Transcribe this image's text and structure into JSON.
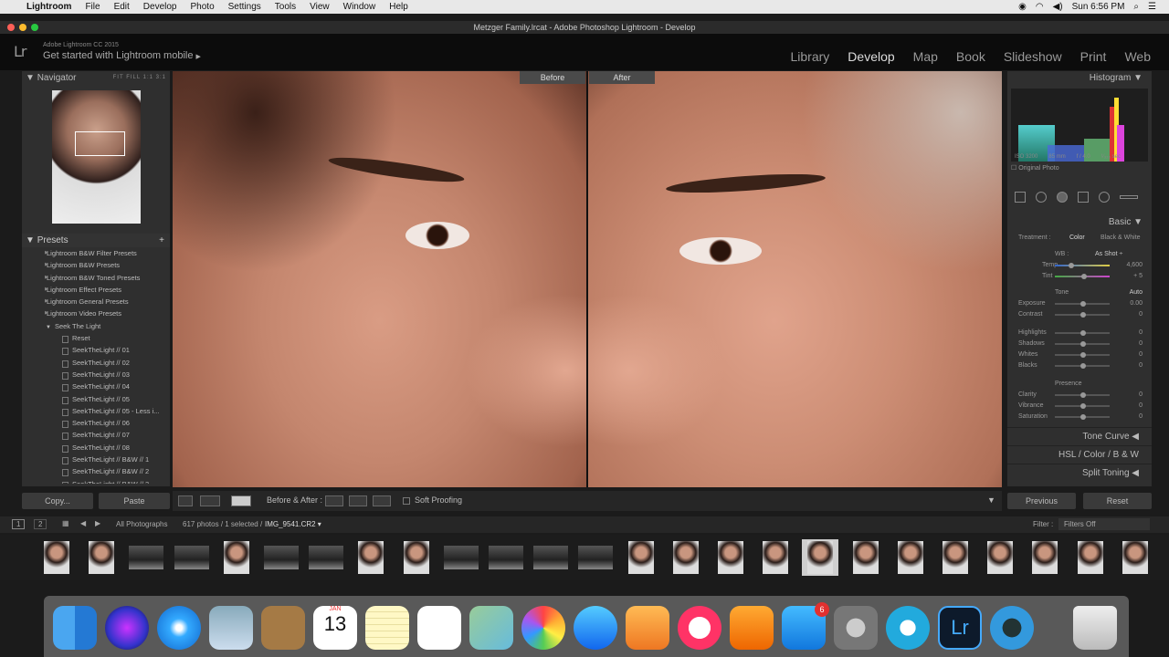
{
  "menubar": {
    "apple": "",
    "app": "Lightroom",
    "items": [
      "File",
      "Edit",
      "Develop",
      "Photo",
      "Settings",
      "Tools",
      "View",
      "Window",
      "Help"
    ],
    "clock": "Sun 6:56 PM"
  },
  "window": {
    "title": "Metzger Family.lrcat - Adobe Photoshop Lightroom - Develop"
  },
  "identity": {
    "logo": "Lr",
    "line1": "Adobe Lightroom CC 2015",
    "line2": "Get started with Lightroom mobile",
    "arrow": "▶"
  },
  "modules": [
    "Library",
    "Develop",
    "Map",
    "Book",
    "Slideshow",
    "Print",
    "Web"
  ],
  "active_module": "Develop",
  "navigator": {
    "title": "Navigator",
    "zoom": "FIT  FILL  1:1  3:1"
  },
  "presets": {
    "title": "Presets",
    "add": "+",
    "groups": [
      "Lightroom B&W Filter Presets",
      "Lightroom B&W Presets",
      "Lightroom B&W Toned Presets",
      "Lightroom Effect Presets",
      "Lightroom General Presets",
      "Lightroom Video Presets"
    ],
    "open_group": "Seek The Light",
    "items": [
      "Reset",
      "SeekTheLight // 01",
      "SeekTheLight // 02",
      "SeekTheLight // 03",
      "SeekTheLight // 04",
      "SeekTheLight // 05",
      "SeekTheLight // 05 - Less i...",
      "SeekTheLight // 06",
      "SeekTheLight // 07",
      "SeekTheLight // 08",
      "SeekTheLight // B&W // 1",
      "SeekTheLight // B&W // 2",
      "SeekTheLight // B&W // 3"
    ]
  },
  "left_buttons": {
    "copy": "Copy...",
    "paste": "Paste"
  },
  "compare": {
    "before": "Before",
    "after": "After"
  },
  "toolbar": {
    "ba_label": "Before & After :",
    "soft_proofing": "Soft Proofing"
  },
  "histogram": {
    "title": "Histogram",
    "iso": "ISO 3200",
    "focal": "85 mm",
    "aperture": "f / 4.0",
    "shutter": "¹⁄₃₂₀ sec",
    "original": "Original Photo"
  },
  "basic": {
    "title": "Basic",
    "treatment_label": "Treatment :",
    "color": "Color",
    "bw": "Black & White",
    "wb_label": "WB :",
    "wb_value": "As Shot ÷",
    "temp": {
      "label": "Temp",
      "value": "4,600"
    },
    "tint": {
      "label": "Tint",
      "value": "+ 5"
    },
    "tone": "Tone",
    "auto": "Auto",
    "tone_sliders": [
      {
        "label": "Exposure",
        "value": "0.00"
      },
      {
        "label": "Contrast",
        "value": "0"
      }
    ],
    "tone_sliders2": [
      {
        "label": "Highlights",
        "value": "0"
      },
      {
        "label": "Shadows",
        "value": "0"
      },
      {
        "label": "Whites",
        "value": "0"
      },
      {
        "label": "Blacks",
        "value": "0"
      }
    ],
    "presence": "Presence",
    "presence_sliders": [
      {
        "label": "Clarity",
        "value": "0"
      },
      {
        "label": "Vibrance",
        "value": "0"
      },
      {
        "label": "Saturation",
        "value": "0"
      }
    ]
  },
  "sections": {
    "tone_curve": "Tone Curve",
    "hsl": "HSL  /  Color  /  B & W",
    "split_toning": "Split Toning"
  },
  "right_buttons": {
    "previous": "Previous",
    "reset": "Reset"
  },
  "filmbar": {
    "page1": "1",
    "page2": "2",
    "source": "All Photographs",
    "count": "617 photos / 1 selected /",
    "filename": "IMG_9541.CR2 ▾",
    "filter_label": "Filter :",
    "filter_value": "Filters Off"
  },
  "filmstrip": {
    "kinds": [
      "p",
      "p",
      "c",
      "c",
      "p",
      "c",
      "c",
      "p",
      "p",
      "c",
      "c",
      "c",
      "c",
      "p",
      "p",
      "p",
      "p",
      "p",
      "p",
      "p",
      "p",
      "p",
      "p",
      "p",
      "p"
    ],
    "selected": 17
  },
  "dock": {
    "calendar_month": "JAN",
    "calendar_day": "13",
    "appstore_badge": "6"
  }
}
